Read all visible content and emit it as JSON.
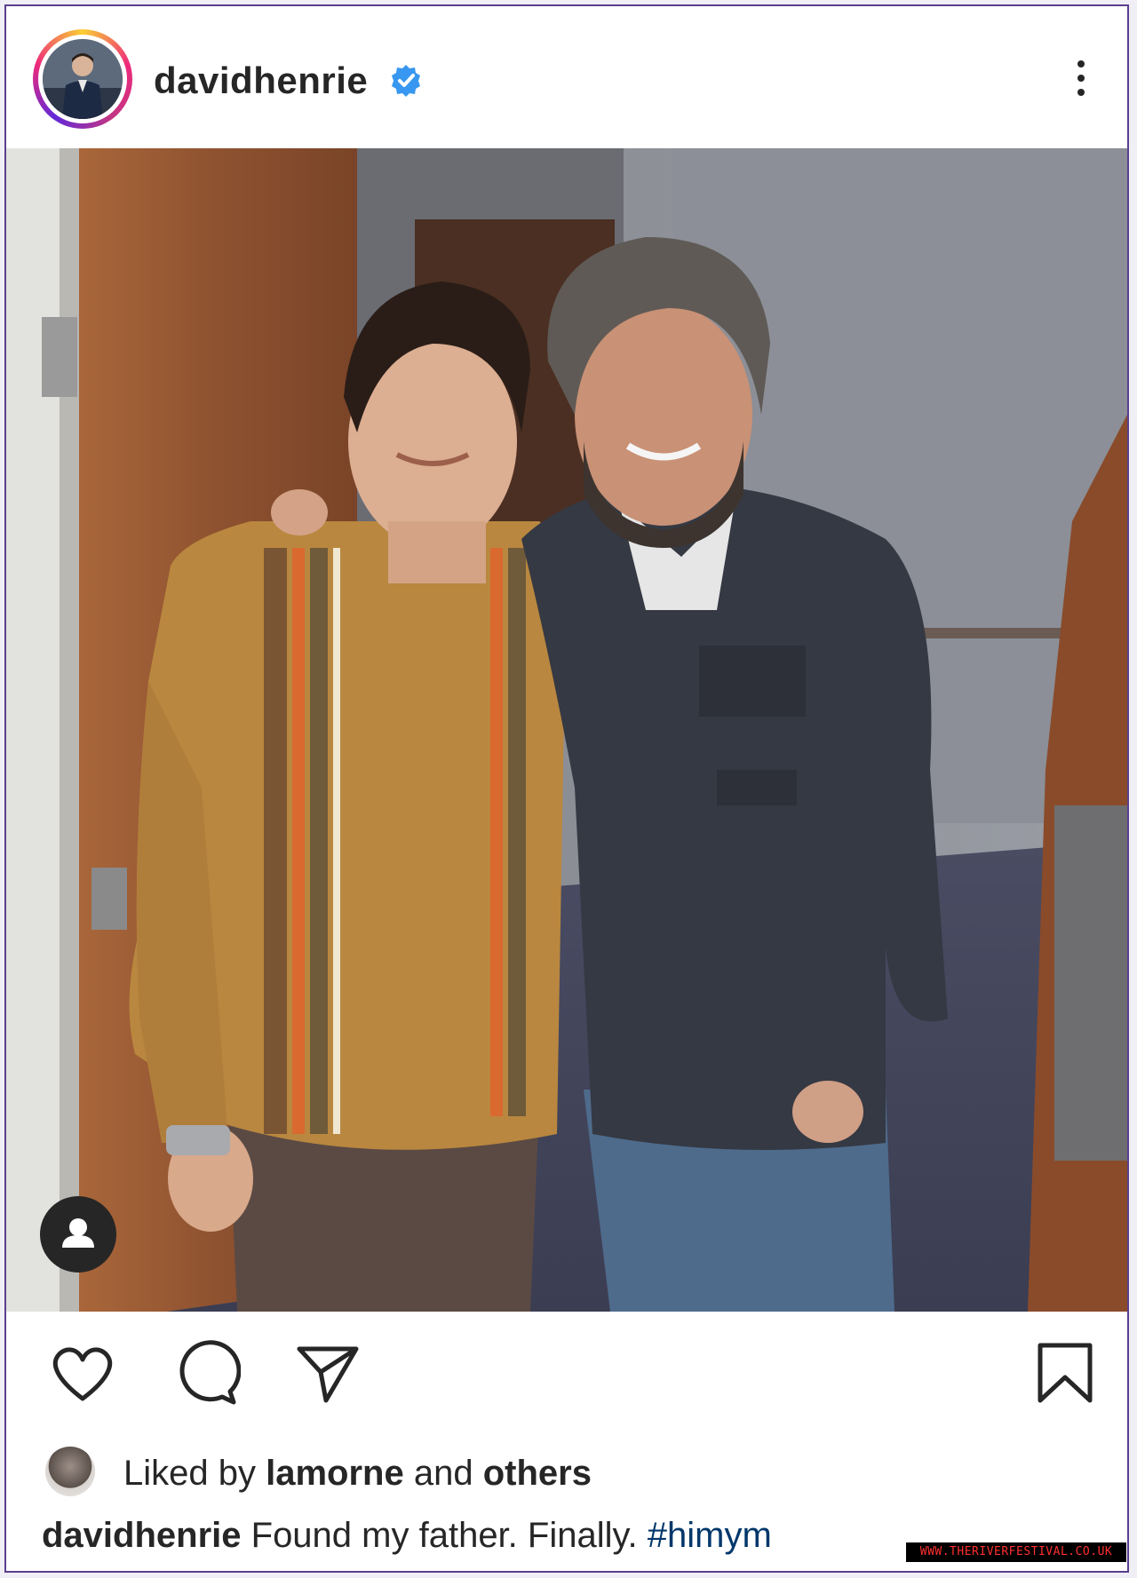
{
  "post": {
    "username": "davidhenrie",
    "verified_icon": "verified-badge-icon",
    "more_icon": "more-options-icon"
  },
  "actions": {
    "like_icon": "heart-icon",
    "comment_icon": "comment-icon",
    "share_icon": "send-icon",
    "save_icon": "bookmark-icon",
    "tag_icon": "user-tag-icon"
  },
  "likes": {
    "prefix": "Liked by ",
    "user": "lamorne",
    "middle": " and ",
    "others": "others"
  },
  "caption": {
    "username": "davidhenrie",
    "text": " Found my father. Finally. ",
    "hashtag": "#himym"
  },
  "watermark": "WWW.THERIVERFESTIVAL.CO.UK",
  "colors": {
    "frame": "#5a3f8f",
    "verified": "#3897f0",
    "hashtag": "#00376b",
    "text": "#262626"
  }
}
